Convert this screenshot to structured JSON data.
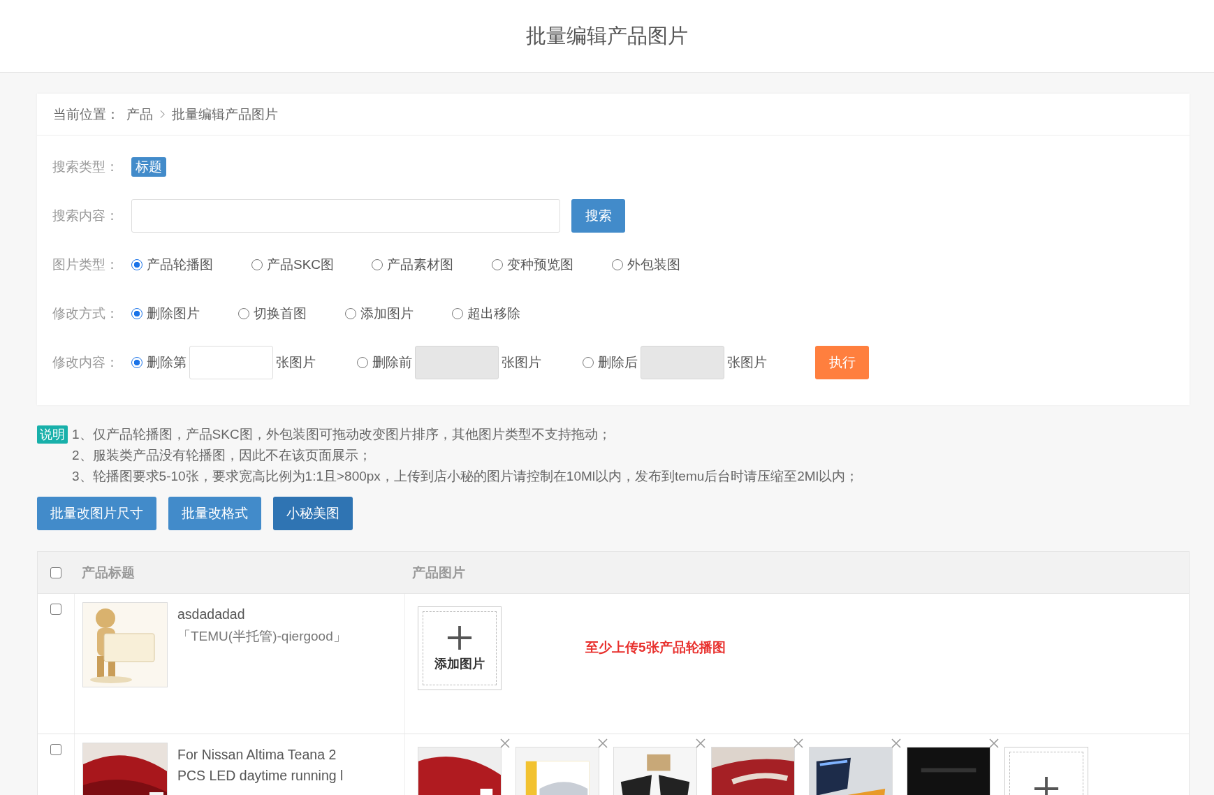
{
  "header": {
    "title": "批量编辑产品图片"
  },
  "breadcrumb": {
    "label": "当前位置：",
    "items": [
      "产品",
      "批量编辑产品图片"
    ]
  },
  "form": {
    "search_type": {
      "label": "搜索类型：",
      "tags": [
        {
          "text": "标题",
          "selected": true
        }
      ]
    },
    "search_content": {
      "label": "搜索内容：",
      "button": "搜索"
    },
    "image_type": {
      "label": "图片类型：",
      "options": [
        {
          "text": "产品轮播图",
          "selected": true
        },
        {
          "text": "产品SKC图",
          "selected": false
        },
        {
          "text": "产品素材图",
          "selected": false
        },
        {
          "text": "变种预览图",
          "selected": false
        },
        {
          "text": "外包装图",
          "selected": false
        }
      ]
    },
    "modify_mode": {
      "label": "修改方式：",
      "options": [
        {
          "text": "删除图片",
          "selected": true
        },
        {
          "text": "切换首图",
          "selected": false
        },
        {
          "text": "添加图片",
          "selected": false
        },
        {
          "text": "超出移除",
          "selected": false
        }
      ]
    },
    "modify_content": {
      "label": "修改内容：",
      "options": [
        {
          "text": "删除第",
          "suffix": "张图片",
          "selected": true,
          "disabled": false
        },
        {
          "text": "删除前",
          "suffix": "张图片",
          "selected": false,
          "disabled": true
        },
        {
          "text": "删除后",
          "suffix": "张图片",
          "selected": false,
          "disabled": true
        }
      ],
      "button": "执行"
    }
  },
  "notes": {
    "badge": "说明",
    "lines": [
      "1、仅产品轮播图，产品SKC图，外包装图可拖动改变图片排序，其他图片类型不支持拖动；",
      "2、服装类产品没有轮播图，因此不在该页面展示；",
      "3、轮播图要求5-10张，要求宽高比例为1:1且>800px，上传到店小秘的图片请控制在10Ml以内，发布到temu后台时请压缩至2Ml以内；"
    ]
  },
  "actions": [
    {
      "text": "批量改图片尺寸",
      "selected": false
    },
    {
      "text": "批量改格式",
      "selected": false
    },
    {
      "text": "小秘美图",
      "selected": true
    }
  ],
  "table": {
    "header_checked": false,
    "columns": [
      "产品标题",
      "产品图片"
    ],
    "rows": [
      {
        "checked": false,
        "title": "asdadadad",
        "store": "「TEMU(半托管)-qiergood」",
        "thumb": {
          "kind": "picture"
        },
        "images": [],
        "add_tile": {
          "label": "添加图片"
        },
        "warning": "至少上传5张产品轮播图"
      },
      {
        "checked": false,
        "title": "For Nissan Altima Teana 2 PCS LED daytime running l",
        "thumb": {
          "kind": "picture"
        },
        "images": [
          {
            "kind": "picture"
          },
          {
            "kind": "picture"
          },
          {
            "kind": "picture"
          },
          {
            "kind": "picture"
          },
          {
            "kind": "picture"
          },
          {
            "kind": "picture"
          }
        ],
        "add_tile": {}
      }
    ]
  }
}
